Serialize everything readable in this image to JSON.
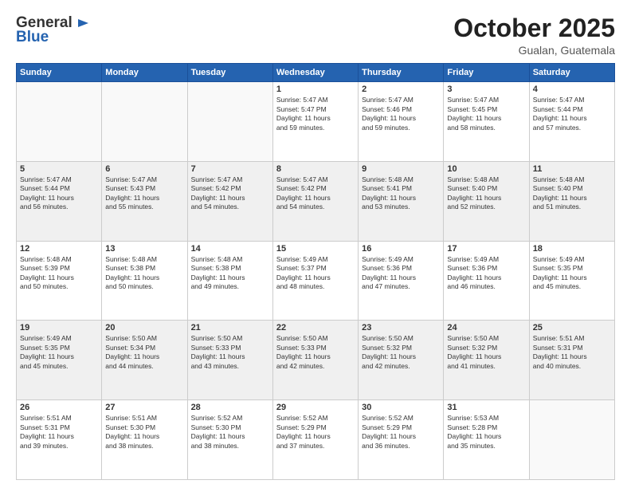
{
  "header": {
    "logo_general": "General",
    "logo_blue": "Blue",
    "month_title": "October 2025",
    "location": "Gualan, Guatemala"
  },
  "weekdays": [
    "Sunday",
    "Monday",
    "Tuesday",
    "Wednesday",
    "Thursday",
    "Friday",
    "Saturday"
  ],
  "weeks": [
    [
      {
        "day": "",
        "info": ""
      },
      {
        "day": "",
        "info": ""
      },
      {
        "day": "",
        "info": ""
      },
      {
        "day": "1",
        "info": "Sunrise: 5:47 AM\nSunset: 5:47 PM\nDaylight: 11 hours\nand 59 minutes."
      },
      {
        "day": "2",
        "info": "Sunrise: 5:47 AM\nSunset: 5:46 PM\nDaylight: 11 hours\nand 59 minutes."
      },
      {
        "day": "3",
        "info": "Sunrise: 5:47 AM\nSunset: 5:45 PM\nDaylight: 11 hours\nand 58 minutes."
      },
      {
        "day": "4",
        "info": "Sunrise: 5:47 AM\nSunset: 5:44 PM\nDaylight: 11 hours\nand 57 minutes."
      }
    ],
    [
      {
        "day": "5",
        "info": "Sunrise: 5:47 AM\nSunset: 5:44 PM\nDaylight: 11 hours\nand 56 minutes."
      },
      {
        "day": "6",
        "info": "Sunrise: 5:47 AM\nSunset: 5:43 PM\nDaylight: 11 hours\nand 55 minutes."
      },
      {
        "day": "7",
        "info": "Sunrise: 5:47 AM\nSunset: 5:42 PM\nDaylight: 11 hours\nand 54 minutes."
      },
      {
        "day": "8",
        "info": "Sunrise: 5:47 AM\nSunset: 5:42 PM\nDaylight: 11 hours\nand 54 minutes."
      },
      {
        "day": "9",
        "info": "Sunrise: 5:48 AM\nSunset: 5:41 PM\nDaylight: 11 hours\nand 53 minutes."
      },
      {
        "day": "10",
        "info": "Sunrise: 5:48 AM\nSunset: 5:40 PM\nDaylight: 11 hours\nand 52 minutes."
      },
      {
        "day": "11",
        "info": "Sunrise: 5:48 AM\nSunset: 5:40 PM\nDaylight: 11 hours\nand 51 minutes."
      }
    ],
    [
      {
        "day": "12",
        "info": "Sunrise: 5:48 AM\nSunset: 5:39 PM\nDaylight: 11 hours\nand 50 minutes."
      },
      {
        "day": "13",
        "info": "Sunrise: 5:48 AM\nSunset: 5:38 PM\nDaylight: 11 hours\nand 50 minutes."
      },
      {
        "day": "14",
        "info": "Sunrise: 5:48 AM\nSunset: 5:38 PM\nDaylight: 11 hours\nand 49 minutes."
      },
      {
        "day": "15",
        "info": "Sunrise: 5:49 AM\nSunset: 5:37 PM\nDaylight: 11 hours\nand 48 minutes."
      },
      {
        "day": "16",
        "info": "Sunrise: 5:49 AM\nSunset: 5:36 PM\nDaylight: 11 hours\nand 47 minutes."
      },
      {
        "day": "17",
        "info": "Sunrise: 5:49 AM\nSunset: 5:36 PM\nDaylight: 11 hours\nand 46 minutes."
      },
      {
        "day": "18",
        "info": "Sunrise: 5:49 AM\nSunset: 5:35 PM\nDaylight: 11 hours\nand 45 minutes."
      }
    ],
    [
      {
        "day": "19",
        "info": "Sunrise: 5:49 AM\nSunset: 5:35 PM\nDaylight: 11 hours\nand 45 minutes."
      },
      {
        "day": "20",
        "info": "Sunrise: 5:50 AM\nSunset: 5:34 PM\nDaylight: 11 hours\nand 44 minutes."
      },
      {
        "day": "21",
        "info": "Sunrise: 5:50 AM\nSunset: 5:33 PM\nDaylight: 11 hours\nand 43 minutes."
      },
      {
        "day": "22",
        "info": "Sunrise: 5:50 AM\nSunset: 5:33 PM\nDaylight: 11 hours\nand 42 minutes."
      },
      {
        "day": "23",
        "info": "Sunrise: 5:50 AM\nSunset: 5:32 PM\nDaylight: 11 hours\nand 42 minutes."
      },
      {
        "day": "24",
        "info": "Sunrise: 5:50 AM\nSunset: 5:32 PM\nDaylight: 11 hours\nand 41 minutes."
      },
      {
        "day": "25",
        "info": "Sunrise: 5:51 AM\nSunset: 5:31 PM\nDaylight: 11 hours\nand 40 minutes."
      }
    ],
    [
      {
        "day": "26",
        "info": "Sunrise: 5:51 AM\nSunset: 5:31 PM\nDaylight: 11 hours\nand 39 minutes."
      },
      {
        "day": "27",
        "info": "Sunrise: 5:51 AM\nSunset: 5:30 PM\nDaylight: 11 hours\nand 38 minutes."
      },
      {
        "day": "28",
        "info": "Sunrise: 5:52 AM\nSunset: 5:30 PM\nDaylight: 11 hours\nand 38 minutes."
      },
      {
        "day": "29",
        "info": "Sunrise: 5:52 AM\nSunset: 5:29 PM\nDaylight: 11 hours\nand 37 minutes."
      },
      {
        "day": "30",
        "info": "Sunrise: 5:52 AM\nSunset: 5:29 PM\nDaylight: 11 hours\nand 36 minutes."
      },
      {
        "day": "31",
        "info": "Sunrise: 5:53 AM\nSunset: 5:28 PM\nDaylight: 11 hours\nand 35 minutes."
      },
      {
        "day": "",
        "info": ""
      }
    ]
  ]
}
